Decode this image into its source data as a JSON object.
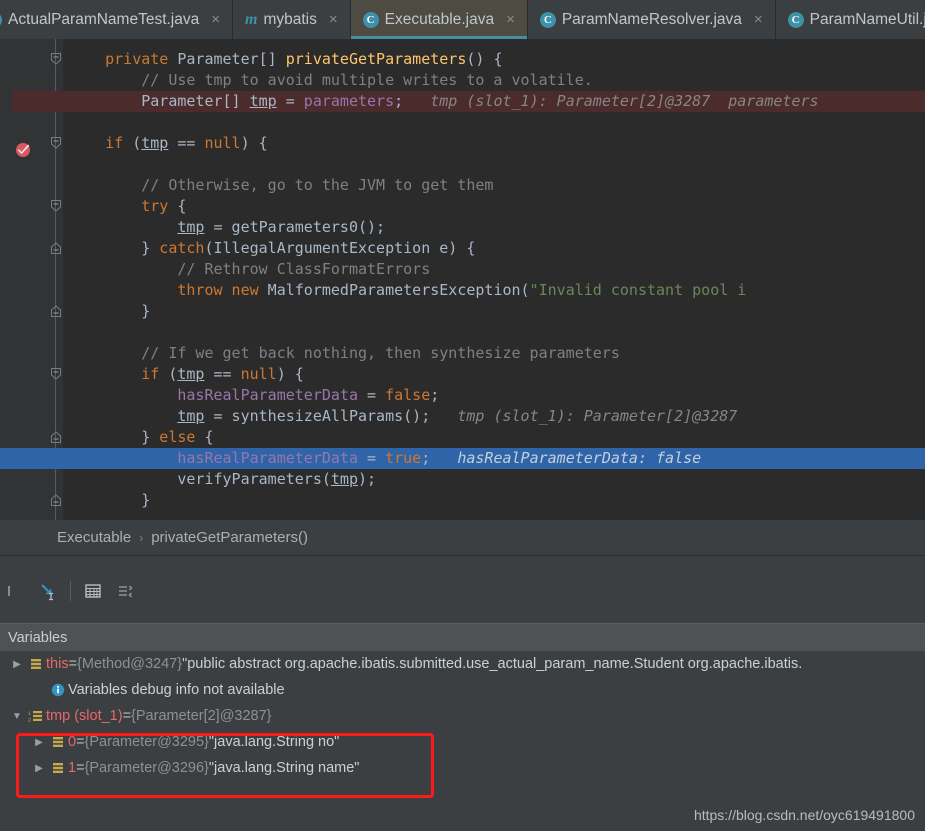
{
  "tabs": [
    {
      "label": "ActualParamNameTest.java",
      "icon": "class-icon",
      "active": false,
      "closable": true,
      "kind": "class"
    },
    {
      "label": "mybatis",
      "icon": "mybatis-icon",
      "active": false,
      "closable": true,
      "kind": "mybatis"
    },
    {
      "label": "Executable.java",
      "icon": "class-icon",
      "active": true,
      "closable": true,
      "kind": "class-shadow"
    },
    {
      "label": "ParamNameResolver.java",
      "icon": "class-icon",
      "active": false,
      "closable": true,
      "kind": "class"
    },
    {
      "label": "ParamNameUtil.jav",
      "icon": "class-icon",
      "active": false,
      "closable": false,
      "kind": "class"
    }
  ],
  "tab_close_glyph": "×",
  "breadcrumb": {
    "class": "Executable",
    "separator": "›",
    "method": "privateGetParameters()"
  },
  "editor": {
    "breakpoint_line": 3,
    "execution_line_text": "hasRealParameterData = true;",
    "lines": [
      {
        "n": 1,
        "indent": 4,
        "state": "normal",
        "fold": "collapse",
        "segs": [
          {
            "t": "private ",
            "c": "kw"
          },
          {
            "t": "Parameter",
            "c": "typ"
          },
          {
            "t": "[] ",
            "c": "pun"
          },
          {
            "t": "privateGetParameters",
            "c": "mth"
          },
          {
            "t": "() {",
            "c": "pun"
          }
        ]
      },
      {
        "n": 2,
        "indent": 8,
        "state": "normal",
        "fold": "",
        "segs": [
          {
            "t": "// Use tmp to avoid multiple writes to a volatile.",
            "c": "com"
          }
        ]
      },
      {
        "n": 3,
        "indent": 8,
        "state": "bp",
        "fold": "",
        "segs": [
          {
            "t": "Parameter",
            "c": "typ"
          },
          {
            "t": "[] ",
            "c": "pun"
          },
          {
            "t": "tmp",
            "c": "var-u"
          },
          {
            "t": " = ",
            "c": "pun"
          },
          {
            "t": "parameters",
            "c": "fld"
          },
          {
            "t": ";",
            "c": "pun"
          },
          {
            "t": "   tmp (slot_1): Parameter[2]@3287  parameters",
            "c": "inlay"
          }
        ]
      },
      {
        "n": 4,
        "indent": 0,
        "state": "normal",
        "fold": "",
        "segs": []
      },
      {
        "n": 5,
        "indent": 4,
        "state": "normal",
        "fold": "collapse",
        "segs": [
          {
            "t": "if",
            "c": "kw"
          },
          {
            "t": " (",
            "c": "pun"
          },
          {
            "t": "tmp",
            "c": "var-u"
          },
          {
            "t": " == ",
            "c": "pun"
          },
          {
            "t": "null",
            "c": "kw"
          },
          {
            "t": ") {",
            "c": "pun"
          }
        ]
      },
      {
        "n": 6,
        "indent": 0,
        "state": "normal",
        "fold": "",
        "segs": []
      },
      {
        "n": 7,
        "indent": 8,
        "state": "normal",
        "fold": "",
        "segs": [
          {
            "t": "// Otherwise, go to the JVM to get them",
            "c": "com"
          }
        ]
      },
      {
        "n": 8,
        "indent": 8,
        "state": "normal",
        "fold": "collapse",
        "segs": [
          {
            "t": "try",
            "c": "kw"
          },
          {
            "t": " {",
            "c": "pun"
          }
        ]
      },
      {
        "n": 9,
        "indent": 12,
        "state": "normal",
        "fold": "",
        "segs": [
          {
            "t": "tmp",
            "c": "var-u"
          },
          {
            "t": " = ",
            "c": "pun"
          },
          {
            "t": "getParameters0",
            "c": "typ"
          },
          {
            "t": "();",
            "c": "pun"
          }
        ]
      },
      {
        "n": 10,
        "indent": 8,
        "state": "normal",
        "fold": "expand",
        "segs": [
          {
            "t": "} ",
            "c": "pun"
          },
          {
            "t": "catch",
            "c": "kw"
          },
          {
            "t": "(",
            "c": "pun"
          },
          {
            "t": "IllegalArgumentException",
            "c": "typ"
          },
          {
            "t": " e) {",
            "c": "pun"
          }
        ]
      },
      {
        "n": 11,
        "indent": 12,
        "state": "normal",
        "fold": "",
        "segs": [
          {
            "t": "// Rethrow ClassFormatErrors",
            "c": "com"
          }
        ]
      },
      {
        "n": 12,
        "indent": 12,
        "state": "normal",
        "fold": "",
        "segs": [
          {
            "t": "throw",
            "c": "kw"
          },
          {
            "t": " ",
            "c": "pun"
          },
          {
            "t": "new",
            "c": "kw"
          },
          {
            "t": " ",
            "c": "pun"
          },
          {
            "t": "MalformedParametersException",
            "c": "typ"
          },
          {
            "t": "(",
            "c": "pun"
          },
          {
            "t": "\"Invalid constant pool i",
            "c": "str"
          }
        ]
      },
      {
        "n": 13,
        "indent": 8,
        "state": "normal",
        "fold": "expand",
        "segs": [
          {
            "t": "}",
            "c": "pun"
          }
        ]
      },
      {
        "n": 14,
        "indent": 0,
        "state": "normal",
        "fold": "",
        "segs": []
      },
      {
        "n": 15,
        "indent": 8,
        "state": "normal",
        "fold": "",
        "segs": [
          {
            "t": "// If we get back nothing, then synthesize parameters",
            "c": "com"
          }
        ]
      },
      {
        "n": 16,
        "indent": 8,
        "state": "normal",
        "fold": "collapse",
        "segs": [
          {
            "t": "if",
            "c": "kw"
          },
          {
            "t": " (",
            "c": "pun"
          },
          {
            "t": "tmp",
            "c": "var-u"
          },
          {
            "t": " == ",
            "c": "pun"
          },
          {
            "t": "null",
            "c": "kw"
          },
          {
            "t": ") {",
            "c": "pun"
          }
        ]
      },
      {
        "n": 17,
        "indent": 12,
        "state": "normal",
        "fold": "",
        "segs": [
          {
            "t": "hasRealParameterData",
            "c": "fld"
          },
          {
            "t": " = ",
            "c": "pun"
          },
          {
            "t": "false",
            "c": "kw"
          },
          {
            "t": ";",
            "c": "pun"
          }
        ]
      },
      {
        "n": 18,
        "indent": 12,
        "state": "normal",
        "fold": "",
        "segs": [
          {
            "t": "tmp",
            "c": "var-u"
          },
          {
            "t": " = ",
            "c": "pun"
          },
          {
            "t": "synthesizeAllParams",
            "c": "typ"
          },
          {
            "t": "();",
            "c": "pun"
          },
          {
            "t": "   tmp (slot_1): Parameter[2]@3287",
            "c": "inlay"
          }
        ]
      },
      {
        "n": 19,
        "indent": 8,
        "state": "normal",
        "fold": "expand",
        "segs": [
          {
            "t": "} ",
            "c": "pun"
          },
          {
            "t": "else",
            "c": "kw"
          },
          {
            "t": " {",
            "c": "pun"
          }
        ]
      },
      {
        "n": 20,
        "indent": 12,
        "state": "exec",
        "fold": "",
        "segs": [
          {
            "t": "hasRealParameterData",
            "c": "fld"
          },
          {
            "t": " = ",
            "c": "pun"
          },
          {
            "t": "true",
            "c": "kw"
          },
          {
            "t": ";",
            "c": "pun"
          },
          {
            "t": "   hasRealParameterData: false",
            "c": "inlay-hl"
          }
        ]
      },
      {
        "n": 21,
        "indent": 12,
        "state": "normal",
        "fold": "",
        "segs": [
          {
            "t": "verifyParameters",
            "c": "typ"
          },
          {
            "t": "(",
            "c": "pun"
          },
          {
            "t": "tmp",
            "c": "var-u"
          },
          {
            "t": ");",
            "c": "pun"
          }
        ]
      },
      {
        "n": 22,
        "indent": 8,
        "state": "normal",
        "fold": "expand",
        "segs": [
          {
            "t": "}",
            "c": "pun"
          }
        ]
      }
    ]
  },
  "debug_toolbar": {
    "buttons": [
      {
        "name": "step-into-icon",
        "label": "Force Step Into"
      },
      {
        "name": "evaluate-table-icon",
        "label": "Evaluate Expression"
      },
      {
        "name": "layout-settings-icon",
        "label": "Settings"
      }
    ]
  },
  "variables_panel": {
    "title": "Variables",
    "rows": [
      {
        "kind": "object",
        "expanded": false,
        "arrow": "▶",
        "icon": "field-icon",
        "name": "this",
        "eq": " = ",
        "ref": "{Method@3247}",
        "value": "\"public abstract org.apache.ibatis.submitted.use_actual_param_name.Student org.apache.ibatis.",
        "indent": 8,
        "highlight": false
      },
      {
        "kind": "info",
        "arrow": "",
        "icon": "info-icon",
        "text": "Variables debug info not available",
        "indent": 30,
        "highlight": false
      },
      {
        "kind": "array",
        "expanded": true,
        "arrow": "▼",
        "icon": "array-icon",
        "name": "tmp (slot_1)",
        "eq": " = ",
        "ref": "{Parameter[2]@3287}",
        "value": "",
        "indent": 8,
        "highlight": false
      },
      {
        "kind": "element",
        "expanded": false,
        "arrow": "▶",
        "icon": "field-icon",
        "name": "0",
        "eq": " = ",
        "ref": "{Parameter@3295}",
        "value": "\"java.lang.String no\"",
        "indent": 30,
        "highlight": true
      },
      {
        "kind": "element",
        "expanded": false,
        "arrow": "▶",
        "icon": "field-icon",
        "name": "1",
        "eq": " = ",
        "ref": "{Parameter@3296}",
        "value": "\"java.lang.String name\"",
        "indent": 30,
        "highlight": true
      }
    ]
  },
  "annotation": {
    "highlight_box_color": "#ff1a1a"
  },
  "watermark": "https://blog.csdn.net/oyc619491800",
  "colors": {
    "editor_bg": "#2b2b2b",
    "panel_bg": "#3c3f41",
    "exec_line": "#2f65a8",
    "breakpoint_line": "#4b2b2b",
    "accent": "#3d91a8"
  }
}
